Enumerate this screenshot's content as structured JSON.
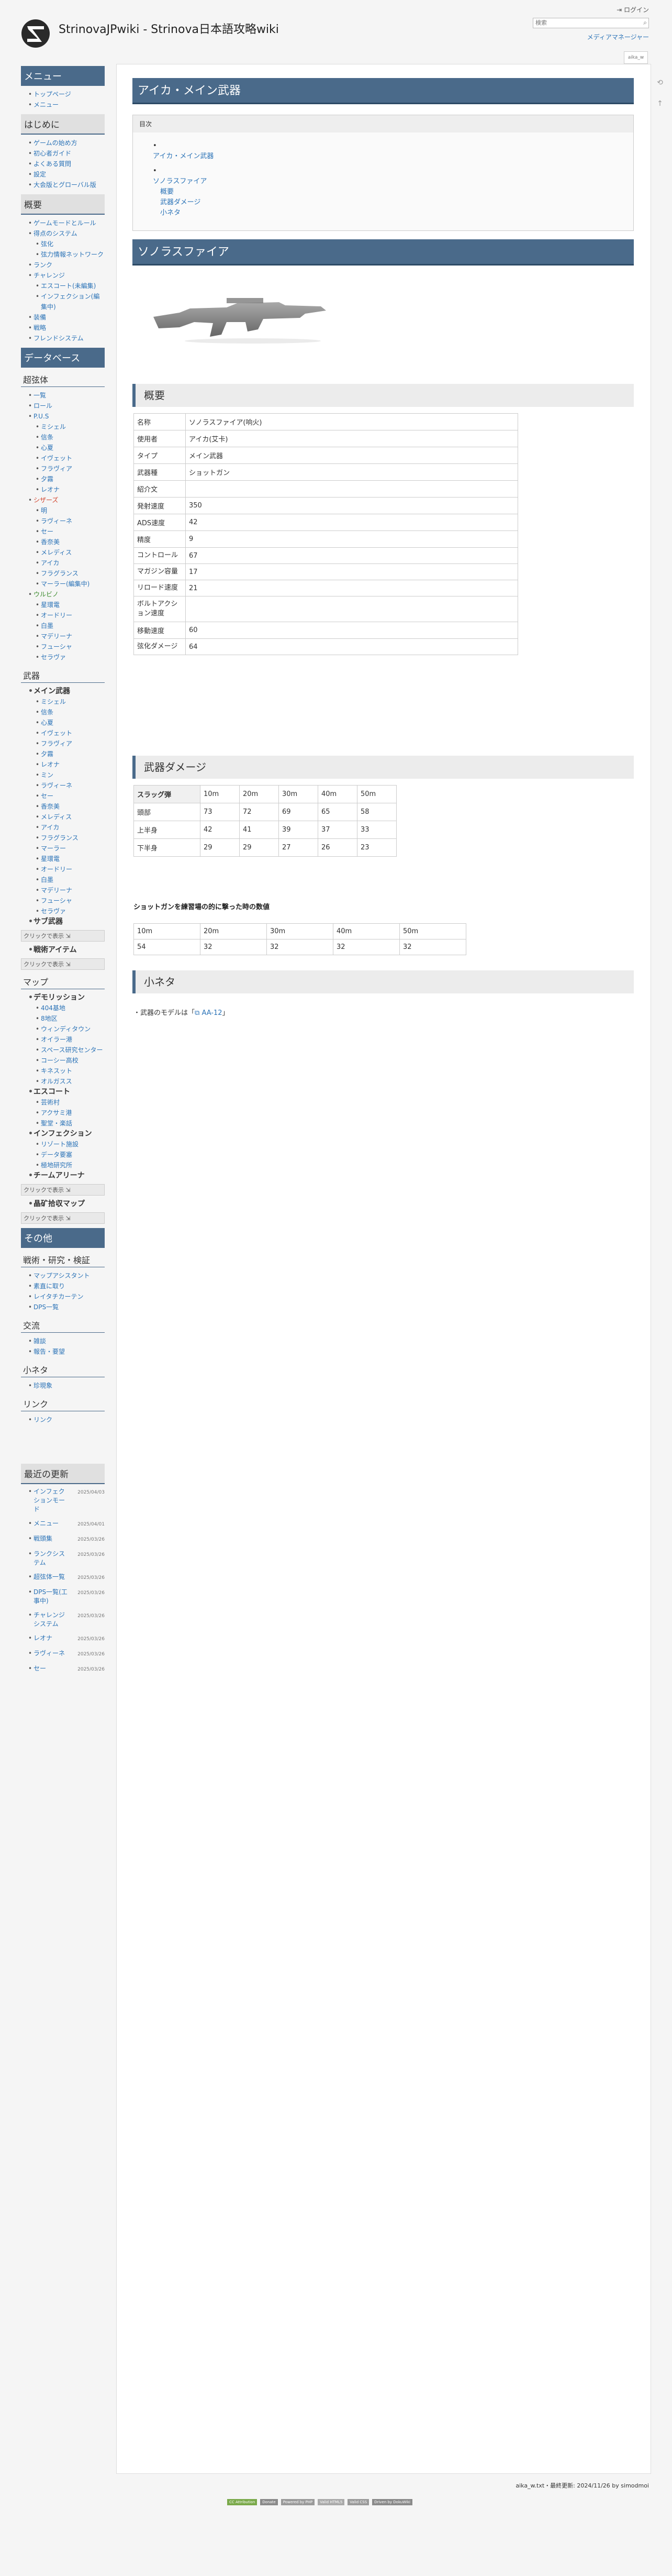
{
  "header": {
    "site_title": "StrinovaJPwiki - Strinova日本語攻略wiki",
    "login": "ログイン",
    "search_placeholder": "検索",
    "search_icon": "search-icon",
    "media_manager": "メディアマネージャー",
    "page_tab": "aika_w"
  },
  "sidebar": {
    "menu_title": "メニュー",
    "menu_items": [
      "トップページ",
      "メニュー"
    ],
    "intro_title": "はじめに",
    "intro_items": [
      "ゲームの始め方",
      "初心者ガイド",
      "よくある質問",
      "設定",
      "大会版とグローバル版"
    ],
    "overview_title": "概要",
    "overview_items": [
      {
        "label": "ゲームモードとルール",
        "sub": false,
        "link": true
      },
      {
        "label": "得点のシステム",
        "sub": false,
        "link": true
      },
      {
        "label": "弦化",
        "sub": true,
        "link": true
      },
      {
        "label": "弦力情報ネットワーク",
        "sub": true,
        "link": true
      },
      {
        "label": "ランク",
        "sub": false,
        "link": true
      },
      {
        "label": "チャレンジ",
        "sub": false,
        "link": true
      },
      {
        "label": "エスコート(未編集)",
        "sub": true,
        "link": true
      },
      {
        "label": "インフェクション(編集中)",
        "sub": true,
        "link": true
      },
      {
        "label": "装備",
        "sub": false,
        "link": true
      },
      {
        "label": "戦略",
        "sub": false,
        "link": true
      },
      {
        "label": "フレンドシステム",
        "sub": false,
        "link": true
      }
    ],
    "database_title": "データベース",
    "supers_title": "超弦体",
    "supers_items": [
      {
        "label": "一覧",
        "sub": false,
        "color": "link"
      },
      {
        "label": "ロール",
        "sub": false,
        "color": "link"
      },
      {
        "label": "P.U.S",
        "sub": false,
        "color": "link"
      },
      {
        "label": "ミシェル",
        "sub": true,
        "color": "link"
      },
      {
        "label": "信条",
        "sub": true,
        "color": "link"
      },
      {
        "label": "心夏",
        "sub": true,
        "color": "link"
      },
      {
        "label": "イヴェット",
        "sub": true,
        "color": "link"
      },
      {
        "label": "フラヴィア",
        "sub": true,
        "color": "link"
      },
      {
        "label": "夕霧",
        "sub": true,
        "color": "link"
      },
      {
        "label": "レオナ",
        "sub": true,
        "color": "link"
      },
      {
        "label": "シザーズ",
        "sub": false,
        "color": "red"
      },
      {
        "label": "明",
        "sub": true,
        "color": "link"
      },
      {
        "label": "ラヴィーネ",
        "sub": true,
        "color": "link"
      },
      {
        "label": "セー",
        "sub": true,
        "color": "link"
      },
      {
        "label": "香奈美",
        "sub": true,
        "color": "link"
      },
      {
        "label": "メレディス",
        "sub": true,
        "color": "link"
      },
      {
        "label": "アイカ",
        "sub": true,
        "color": "link"
      },
      {
        "label": "フラグランス",
        "sub": true,
        "color": "link"
      },
      {
        "label": "マーラー(編集中)",
        "sub": true,
        "color": "link"
      },
      {
        "label": "ウルビノ",
        "sub": false,
        "color": "green"
      },
      {
        "label": "星環電",
        "sub": true,
        "color": "link"
      },
      {
        "label": "オードリー",
        "sub": true,
        "color": "link"
      },
      {
        "label": "白墨",
        "sub": true,
        "color": "link"
      },
      {
        "label": "マデリーナ",
        "sub": true,
        "color": "link"
      },
      {
        "label": "フューシャ",
        "sub": true,
        "color": "link"
      },
      {
        "label": "セラヴァ",
        "sub": true,
        "color": "link"
      }
    ],
    "weapons_title": "武器",
    "weapons_items": [
      {
        "label": "メイン武器",
        "sub": false,
        "bold": true
      },
      {
        "label": "ミシェル",
        "sub": true
      },
      {
        "label": "信条",
        "sub": true
      },
      {
        "label": "心夏",
        "sub": true
      },
      {
        "label": "イヴェット",
        "sub": true
      },
      {
        "label": "フラヴィア",
        "sub": true
      },
      {
        "label": "夕霧",
        "sub": true
      },
      {
        "label": "レオナ",
        "sub": true
      },
      {
        "label": "ミン",
        "sub": true
      },
      {
        "label": "ラヴィーネ",
        "sub": true
      },
      {
        "label": "セー",
        "sub": true
      },
      {
        "label": "香奈美",
        "sub": true
      },
      {
        "label": "メレディス",
        "sub": true
      },
      {
        "label": "アイカ",
        "sub": true
      },
      {
        "label": "フラグランス",
        "sub": true
      },
      {
        "label": "マーラー",
        "sub": true
      },
      {
        "label": "星環電",
        "sub": true
      },
      {
        "label": "オードリー",
        "sub": true
      },
      {
        "label": "白墨",
        "sub": true
      },
      {
        "label": "マデリーナ",
        "sub": true
      },
      {
        "label": "フューシャ",
        "sub": true
      },
      {
        "label": "セラヴァ",
        "sub": true
      },
      {
        "label": "サブ武器",
        "sub": false,
        "bold": true
      }
    ],
    "toggle_label": "クリックで表示",
    "tactical_label": "戦術アイテム",
    "map_title": "マップ",
    "map_items": [
      {
        "label": "デモリッション",
        "sub": false,
        "bold": true
      },
      {
        "label": "404基地",
        "sub": true
      },
      {
        "label": "8地区",
        "sub": true
      },
      {
        "label": "ウィンディタウン",
        "sub": true
      },
      {
        "label": "オイラー港",
        "sub": true
      },
      {
        "label": "スペース研究センター",
        "sub": true
      },
      {
        "label": "コーシー高校",
        "sub": true
      },
      {
        "label": "キネスット",
        "sub": true
      },
      {
        "label": "オルガスス",
        "sub": true
      },
      {
        "label": "エスコート",
        "sub": false,
        "bold": true
      },
      {
        "label": "芸術村",
        "sub": true
      },
      {
        "label": "アクサミ港",
        "sub": true
      },
      {
        "label": "聖堂・楽話",
        "sub": true
      },
      {
        "label": "インフェクション",
        "sub": false,
        "bold": true
      },
      {
        "label": "リゾート施設",
        "sub": true
      },
      {
        "label": "データ要塞",
        "sub": true
      },
      {
        "label": "極地研究所",
        "sub": true
      },
      {
        "label": "チームアリーナ",
        "sub": false,
        "bold": true
      }
    ],
    "crystal_label": "晶矿拾収マップ",
    "other_title": "その他",
    "training_title": "戦術・研究・検証",
    "training_items": [
      "マップアシスタント",
      "素直に取り",
      "レイタチカーテン",
      "DPS一覧"
    ],
    "exchange_title": "交流",
    "exchange_items": [
      "雑談",
      "報告・要望"
    ],
    "trivia_title": "小ネタ",
    "trivia_items": [
      "珍現象"
    ],
    "links_title": "リンク",
    "links_items": [
      "リンク"
    ],
    "recent_title": "最近の更新",
    "recent_items": [
      {
        "label": "インフェクションモード",
        "date": "2025/04/03"
      },
      {
        "label": "メニュー",
        "date": "2025/04/01"
      },
      {
        "label": "戦頭集",
        "date": "2025/03/26"
      },
      {
        "label": "ランクシステム",
        "date": "2025/03/26"
      },
      {
        "label": "超弦体一覧",
        "date": "2025/03/26"
      },
      {
        "label": "DPS一覧(工事中)",
        "date": "2025/03/26"
      },
      {
        "label": "チャレンジシステム",
        "date": "2025/03/26"
      },
      {
        "label": "レオナ",
        "date": "2025/03/26"
      },
      {
        "label": "ラヴィーネ",
        "date": "2025/03/26"
      },
      {
        "label": "セー",
        "date": "2025/03/26"
      }
    ]
  },
  "main": {
    "page_title": "アイカ・メイン武器",
    "toc": {
      "title": "目次",
      "items": [
        {
          "label": "アイカ・メイン武器",
          "level": 1
        },
        {
          "label": "ソノラスファイア",
          "level": 1
        },
        {
          "label": "概要",
          "level": 2
        },
        {
          "label": "武器ダメージ",
          "level": 2
        },
        {
          "label": "小ネタ",
          "level": 2
        }
      ]
    },
    "weapon_name_heading": "ソノラスファイア",
    "overview_heading": "概要",
    "info_rows": [
      {
        "k": "名称",
        "v": "ソノラスファイア(响火)",
        "style": ""
      },
      {
        "k": "使用者",
        "v": "アイカ(艾卡)",
        "style": "green"
      },
      {
        "k": "タイプ",
        "v": "メイン武器",
        "style": ""
      },
      {
        "k": "武器種",
        "v": "ショットガン",
        "style": ""
      },
      {
        "k": "紹介文",
        "v": "",
        "style": ""
      },
      {
        "k": "発射速度",
        "v": "350",
        "style": ""
      },
      {
        "k": "ADS速度",
        "v": "42",
        "style": ""
      },
      {
        "k": "精度",
        "v": "9",
        "style": ""
      },
      {
        "k": "コントロール",
        "v": "67",
        "style": ""
      },
      {
        "k": "マガジン容量",
        "v": "17",
        "style": ""
      },
      {
        "k": "リロード速度",
        "v": "21",
        "style": ""
      },
      {
        "k": "ボルトアクション速度",
        "v": "",
        "style": ""
      },
      {
        "k": "移動速度",
        "v": "60",
        "style": ""
      },
      {
        "k": "弦化ダメージ",
        "v": "64",
        "style": ""
      }
    ],
    "damage_heading": "武器ダメージ",
    "damage_table": {
      "header": [
        "スラッグ弾",
        "10m",
        "20m",
        "30m",
        "40m",
        "50m"
      ],
      "rows": [
        [
          "頭部",
          "73",
          "72",
          "69",
          "65",
          "58"
        ],
        [
          "上半身",
          "42",
          "41",
          "39",
          "37",
          "33"
        ],
        [
          "下半身",
          "29",
          "29",
          "27",
          "26",
          "23"
        ]
      ]
    },
    "note_title": "ショットガンを練習場の的に撃った時の数値",
    "note_table": {
      "header": [
        "10m",
        "20m",
        "30m",
        "40m",
        "50m"
      ],
      "row": [
        "54",
        "32",
        "32",
        "32",
        "32"
      ]
    },
    "trivia_heading": "小ネタ",
    "trivia_prefix": "・武器のモデルは「",
    "trivia_link": "AA-12",
    "trivia_suffix": "」"
  },
  "footer": {
    "file": "aika_w.txt",
    "updated": "・最終更新: 2024/11/26 by simodmoi",
    "badges": [
      "CC Attribution",
      "Donate",
      "Powered by PHP",
      "Valid HTML5",
      "Valid CSS",
      "Driven by DokuWiki"
    ]
  }
}
